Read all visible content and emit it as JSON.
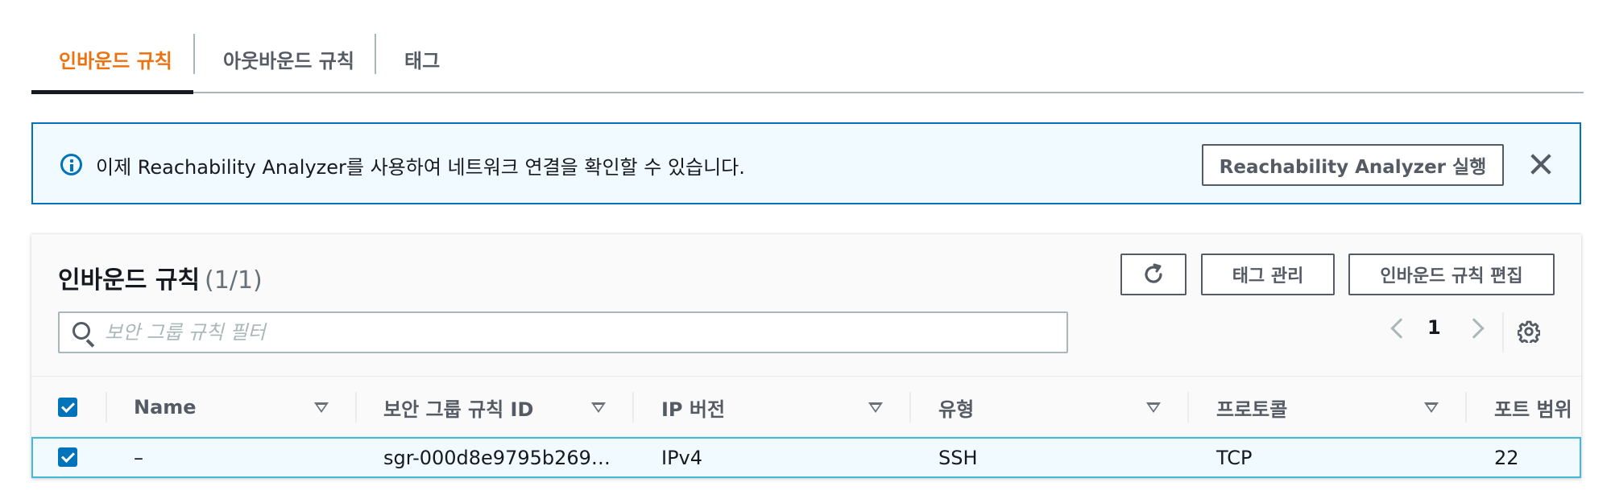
{
  "tabs": [
    {
      "label": "인바운드 규칙",
      "active": true
    },
    {
      "label": "아웃바운드 규칙",
      "active": false
    },
    {
      "label": "태그",
      "active": false
    }
  ],
  "flash": {
    "message": "이제 Reachability Analyzer를 사용하여 네트워크 연결을 확인할 수 있습니다.",
    "button_label": "Reachability Analyzer 실행",
    "icon": "info-icon"
  },
  "panel": {
    "title": "인바운드 규칙",
    "count": "(1/1)",
    "refresh_icon": "refresh-icon",
    "manage_tags_label": "태그 관리",
    "edit_rules_label": "인바운드 규칙 편집",
    "search_placeholder": "보안 그룹 규칙 필터",
    "page": "1"
  },
  "table": {
    "columns": [
      "Name",
      "보안 그룹 규칙 ID",
      "IP 버전",
      "유형",
      "프로토콜",
      "포트 범위"
    ],
    "rows": [
      {
        "selected": true,
        "name": "–",
        "rule_id": "sgr-000d8e9795b269…",
        "ip_version": "IPv4",
        "type": "SSH",
        "protocol": "TCP",
        "port_range": "22"
      }
    ]
  },
  "colors": {
    "accent": "#ec7211",
    "info": "#0073bb",
    "selected_row_bg": "#f1faff",
    "selected_row_border": "#44b9d6"
  }
}
